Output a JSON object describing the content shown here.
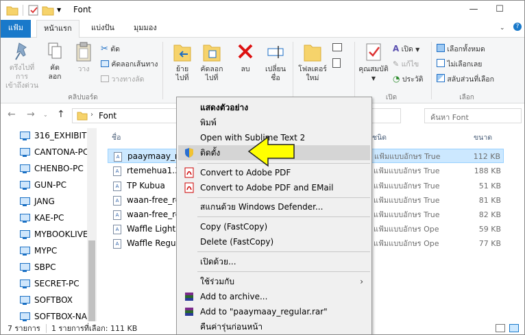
{
  "window": {
    "title": "Font"
  },
  "window_controls": {
    "minimize": "—",
    "maximize": "☐"
  },
  "ribbon_tabs": {
    "file": "แฟ้ม",
    "home": "หน้าแรก",
    "share": "แบ่งปัน",
    "view": "มุมมอง"
  },
  "ribbon": {
    "pin_line1": "ตรึงไปที่การ",
    "pin_line2": "เข้าถึงด่วน",
    "copy_line1": "คัด",
    "copy_line2": "ลอก",
    "paste": "วาง",
    "cut": "ตัด",
    "copy_path": "คัดลอกเส้นทาง",
    "paste_shortcut": "วางทางลัด",
    "clipboard_group": "คลิปบอร์ด",
    "move_line1": "ย้าย",
    "move_line2": "ไปที่",
    "copyto_line1": "คัดลอก",
    "copyto_line2": "ไปที่",
    "delete": "ลบ",
    "rename_line1": "เปลี่ยน",
    "rename_line2": "ชื่อ",
    "newfolder_line1": "โฟลเดอร์",
    "newfolder_line2": "ใหม่",
    "properties": "คุณสมบัติ",
    "open": "เปิด",
    "edit": "แก้ไข",
    "history": "ประวัติ",
    "open_group": "เปิด",
    "select_all": "เลือกทั้งหมด",
    "select_none": "ไม่เลือกเลย",
    "invert_selection": "สลับส่วนที่เลือก",
    "select_group": "เลือก"
  },
  "address": {
    "path": "Font",
    "search_placeholder": "ค้นหา Font"
  },
  "nav_items": [
    "316_EXHIBITION",
    "CANTONA-PC",
    "CHENBO-PC",
    "GUN-PC",
    "JANG",
    "KAE-PC",
    "MYBOOKLIVE",
    "MYPC",
    "SBPC",
    "SECRET-PC",
    "SOFTBOX",
    "SOFTBOX-NAS"
  ],
  "columns": {
    "name": "ชื่อ",
    "type": "ชนิด",
    "size": "ขนาด"
  },
  "files": [
    {
      "name": "paaymaay_regular",
      "type": "แฟ้มแบบอักษร TrueType",
      "size": "112 KB",
      "selected": true
    },
    {
      "name": "rtemehua1.35",
      "type": "แฟ้มแบบอักษร TrueType",
      "size": "188 KB",
      "selected": false
    },
    {
      "name": "TP Kubua",
      "type": "แฟ้มแบบอักษร TrueType",
      "size": "51 KB",
      "selected": false
    },
    {
      "name": "waan-free_regular",
      "type": "แฟ้มแบบอักษร TrueType",
      "size": "81 KB",
      "selected": false
    },
    {
      "name": "waan-free_regular",
      "type": "แฟ้มแบบอักษร TrueType",
      "size": "82 KB",
      "selected": false
    },
    {
      "name": "Waffle Light",
      "type": "แฟ้มแบบอักษร OpenType",
      "size": "59 KB",
      "selected": false
    },
    {
      "name": "Waffle Regular",
      "type": "แฟ้มแบบอักษร OpenType",
      "size": "77 KB",
      "selected": false
    }
  ],
  "status": {
    "count": "7 รายการ",
    "selected": "1 รายการที่เลือก: 111 KB"
  },
  "context_menu": {
    "preview": "แสดงตัวอย่าง",
    "print": "พิมพ์",
    "sublime": "Open with Sublime Text 2",
    "install": "ติดตั้ง",
    "convert_pdf": "Convert to Adobe PDF",
    "convert_pdf_email": "Convert to Adobe PDF and EMail",
    "defender": "สแกนด้วย Windows Defender...",
    "fastcopy_copy": "Copy (FastCopy)",
    "fastcopy_delete": "Delete (FastCopy)",
    "open_with": "เปิดด้วย...",
    "share_with": "ใช้ร่วมกับ",
    "add_archive": "Add to archive...",
    "add_rar": "Add to \"paaymaay_regular.rar\"",
    "restore": "คืนค่ารุ่นก่อนหน้า"
  },
  "colors": {
    "accent": "#1979ca",
    "selection": "#cce8ff",
    "arrow": "#ffff00"
  }
}
